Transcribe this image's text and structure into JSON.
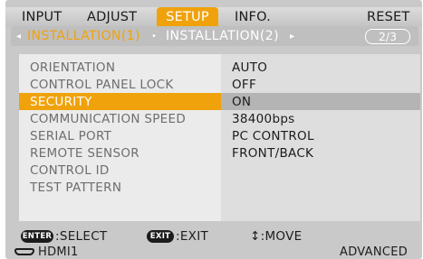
{
  "tabs": [
    {
      "label": "INPUT"
    },
    {
      "label": "ADJUST"
    },
    {
      "label": "SETUP",
      "active": true
    },
    {
      "label": "INFO."
    },
    {
      "label": "RESET"
    }
  ],
  "subtabs": {
    "left_arrow": "◂",
    "items": [
      {
        "label": "INSTALLATION(1)",
        "active": true
      },
      {
        "label": "INSTALLATION(2)"
      }
    ],
    "separator": "•",
    "right_arrow": "▸",
    "page": "2/3"
  },
  "rows": [
    {
      "label": "ORIENTATION",
      "value": "AUTO"
    },
    {
      "label": "CONTROL PANEL LOCK",
      "value": "OFF"
    },
    {
      "label": "SECURITY",
      "value": "ON",
      "selected": true
    },
    {
      "label": "COMMUNICATION SPEED",
      "value": "38400bps"
    },
    {
      "label": "SERIAL PORT",
      "value": "PC CONTROL"
    },
    {
      "label": "REMOTE SENSOR",
      "value": "FRONT/BACK"
    },
    {
      "label": "CONTROL ID",
      "value": ""
    },
    {
      "label": "TEST PATTERN",
      "value": ""
    }
  ],
  "footer": {
    "enter_key": "ENTER",
    "select_text": ":SELECT",
    "exit_key": "EXIT",
    "exit_text": ":EXIT",
    "move_text": "↕:MOVE"
  },
  "status": {
    "input": "HDMI1",
    "mode": "ADVANCED"
  },
  "colors": {
    "accent": "#f0a20c",
    "background": "#c9c9c9",
    "panel": "#ebebeb",
    "selected_value_bg": "#b4b4b4"
  }
}
